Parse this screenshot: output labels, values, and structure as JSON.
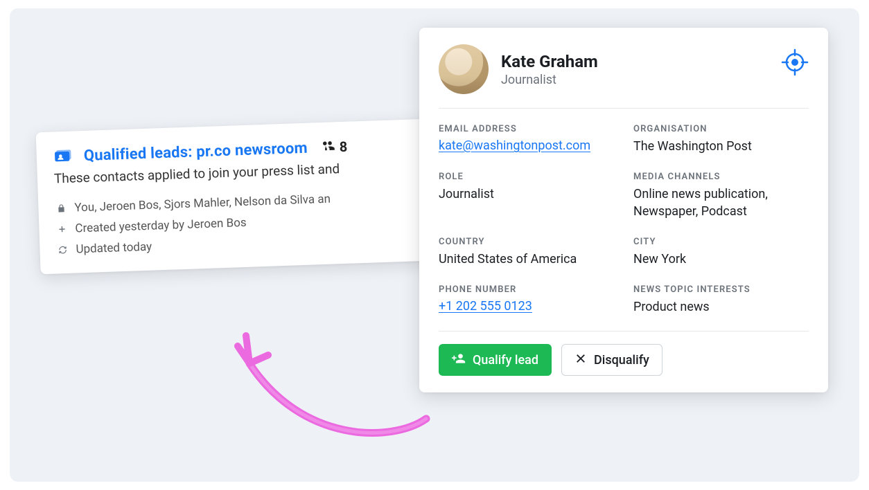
{
  "left_card": {
    "title": "Qualified leads: pr.co newsroom",
    "count": "8",
    "description": "These contacts applied to join your press list and",
    "members": "You, Jeroen Bos, Sjors Mahler, Nelson da Silva an",
    "created": "Created yesterday by Jeroen Bos",
    "updated": "Updated today"
  },
  "contact": {
    "name": "Kate Graham",
    "subtitle": "Journalist",
    "fields": {
      "email_label": "EMAIL ADDRESS",
      "email_value": "kate@washingtonpost.com",
      "organisation_label": "ORGANISATION",
      "organisation_value": "The Washington Post",
      "role_label": "ROLE",
      "role_value": "Journalist",
      "media_channels_label": "MEDIA CHANNELS",
      "media_channels_value": "Online news publication, Newspaper, Podcast",
      "country_label": "COUNTRY",
      "country_value": "United States of America",
      "city_label": "CITY",
      "city_value": "New York",
      "phone_label": "PHONE NUMBER",
      "phone_value": "+1 202 555 0123",
      "interests_label": "NEWS TOPIC INTERESTS",
      "interests_value": "Product news"
    },
    "actions": {
      "qualify": "Qualify lead",
      "disqualify": "Disqualify"
    }
  }
}
